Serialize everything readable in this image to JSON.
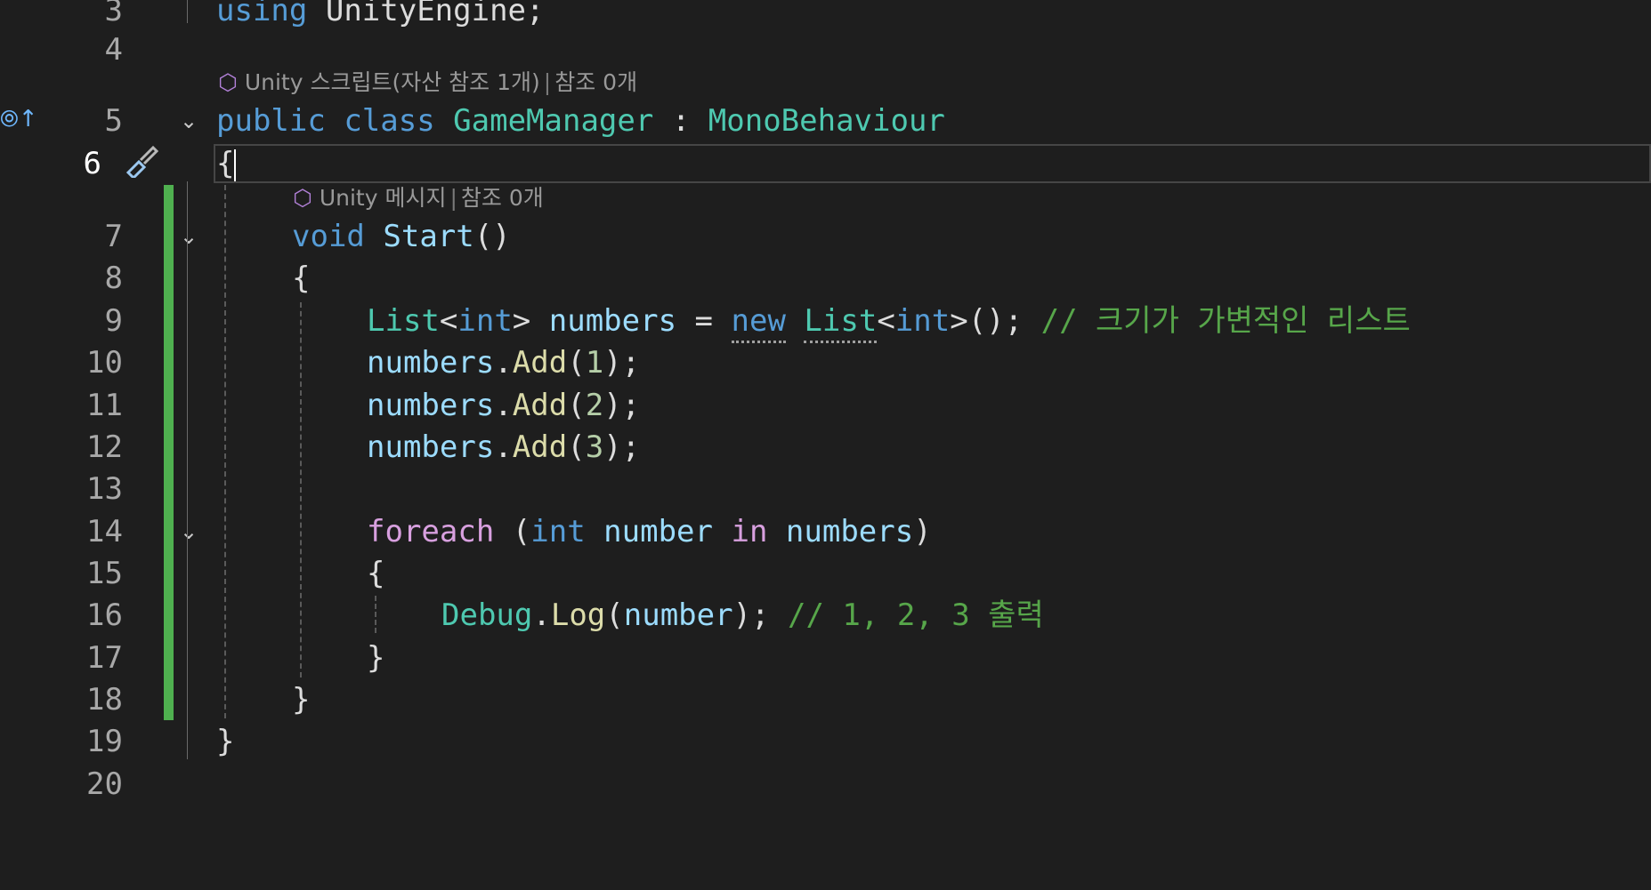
{
  "editor": {
    "line_numbers": [
      "3",
      "4",
      "5",
      "6",
      "7",
      "8",
      "9",
      "10",
      "11",
      "12",
      "13",
      "14",
      "15",
      "16",
      "17",
      "18",
      "19",
      "20"
    ],
    "current_line": "6",
    "codelens": {
      "class_unity": "Unity 스크립트(자산 참조 1개)",
      "class_refs": "참조 0개",
      "method_unity": "Unity 메시지",
      "method_refs": "참조 0개"
    },
    "tokens": {
      "using": "using",
      "unity_engine": "UnityEngine",
      "semicolon": ";",
      "public": "public",
      "class": "class",
      "game_manager": "GameManager",
      "colon": ":",
      "mono_behaviour": "MonoBehaviour",
      "open_brace": "{",
      "close_brace": "}",
      "void": "void",
      "start": "Start",
      "parens": "()",
      "list": "List",
      "lt": "<",
      "gt": ">",
      "int": "int",
      "numbers": "numbers",
      "equals": "=",
      "new": "new",
      "call_end": "();",
      "comment_list": "// 크기가 가변적인 리스트",
      "dot": ".",
      "add": "Add",
      "open_paren": "(",
      "close_paren_semi": ");",
      "one": "1",
      "two": "2",
      "three": "3",
      "foreach": "foreach",
      "number": "number",
      "in": "in",
      "close_paren": ")",
      "debug": "Debug",
      "log": "Log",
      "comment_print": "// 1, 2, 3 출력"
    }
  },
  "colors": {
    "background": "#1e1e1e",
    "keyword": "#569cd6",
    "control": "#d8a0df",
    "type": "#4ec9b0",
    "method": "#dcdcaa",
    "variable": "#9cdcfe",
    "number": "#b5cea8",
    "comment": "#57a64a",
    "change_bar": "#4fb04f"
  },
  "icons": {
    "gutter_refs": "references-up-icon",
    "gutter_quick_action": "brush-icon",
    "fold": "chevron-down-icon",
    "codelens": "unity-cube-icon"
  }
}
